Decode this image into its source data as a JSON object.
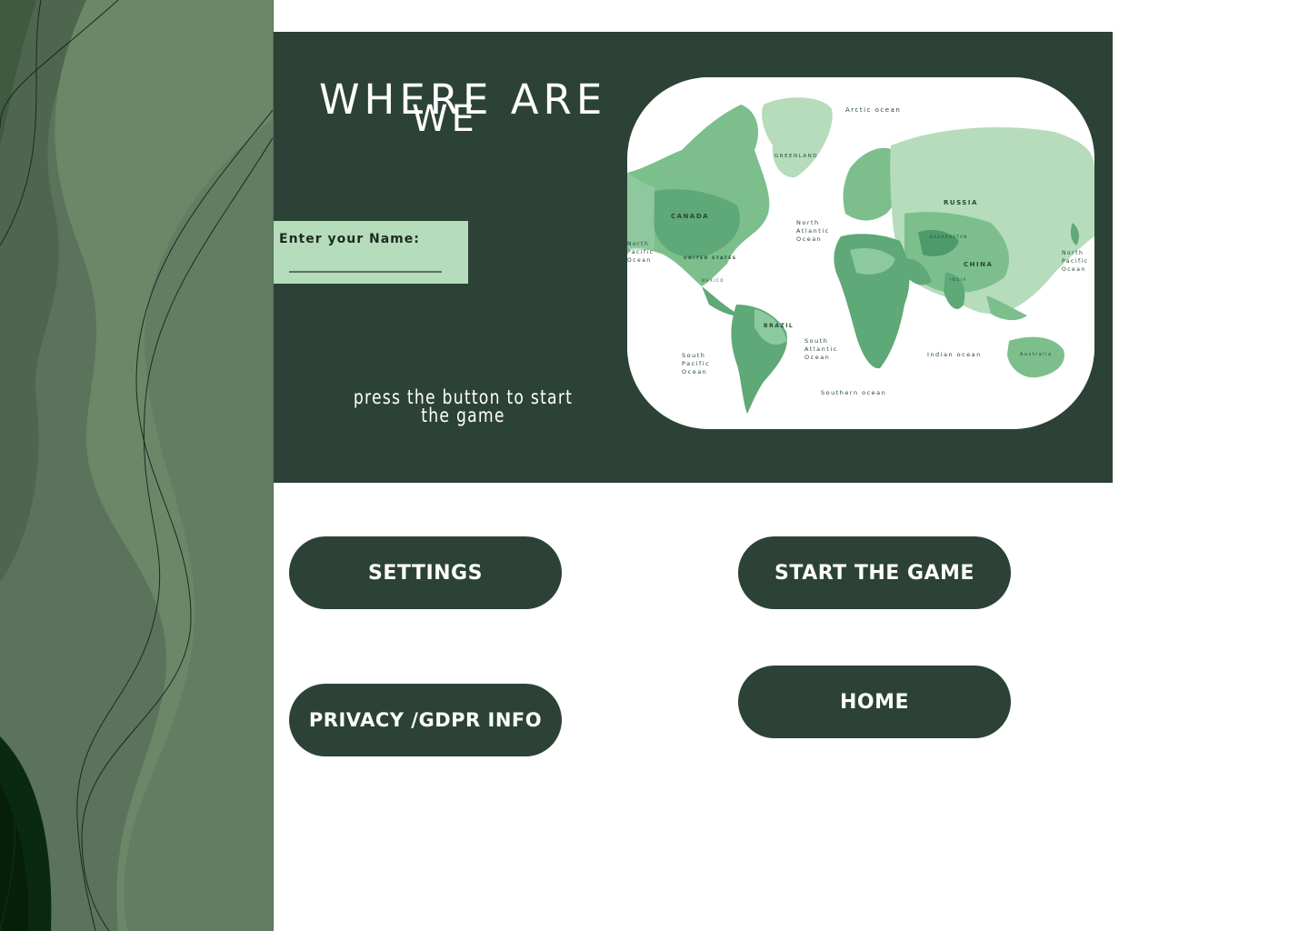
{
  "hero": {
    "title_line1": "WHERE ARE",
    "title_line2": "WE",
    "name_label": "Enter your Name:",
    "name_value": "",
    "instructions": "press the button to start the game"
  },
  "map": {
    "labels": {
      "arctic": "Arctic ocean",
      "greenland": "GREENLAND",
      "canada": "CANADA",
      "russia": "RUSSIA",
      "china": "CHINA",
      "brazil": "BRAZIL",
      "united_states": "UNITED STATES",
      "mexico": "MEXICO",
      "kazakhstan": "KAZAKHSTAN",
      "india": "INDIA",
      "australia": "Australia",
      "north_atlantic": "North Atlantic Ocean",
      "south_atlantic": "South Atlantic Ocean",
      "north_pacific_left": "North Pacific Ocean",
      "north_pacific_right": "North Pacific Ocean",
      "south_pacific": "South Pacific Ocean",
      "indian": "Indian ocean",
      "southern": "Southern ocean"
    }
  },
  "buttons": {
    "settings": "SETTINGS",
    "start": "START THE GAME",
    "privacy": "PRIVACY /GDPR INFO",
    "home": "HOME"
  },
  "colors": {
    "dark_green": "#2c4236",
    "mint": "#b5dcbb",
    "sidebar_green": "#637d63",
    "sidebar_dark": "#0a2a10"
  }
}
